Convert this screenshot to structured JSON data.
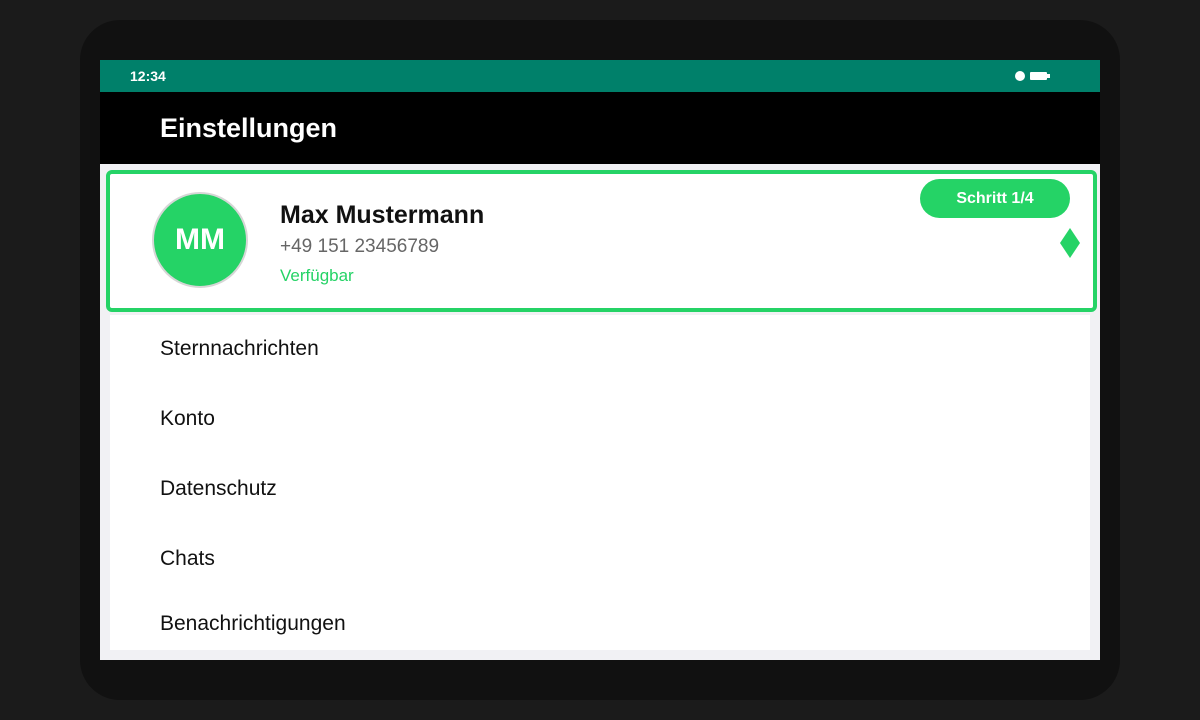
{
  "status_bar": {
    "time": "12:34",
    "icons": [
      "signal-dot-icon",
      "battery-icon"
    ]
  },
  "app_bar": {
    "title": "Einstellungen"
  },
  "profile": {
    "initials": "MM",
    "name": "Max Mustermann",
    "phone": "+49 151 23456789",
    "status": "Verfügbar"
  },
  "tour": {
    "step_label": "Schritt 1/4",
    "pointer_icon": "diamond-pointer-icon"
  },
  "settings": {
    "items": [
      {
        "label": "Sternnachrichten"
      },
      {
        "label": "Konto"
      },
      {
        "label": "Datenschutz"
      },
      {
        "label": "Chats"
      },
      {
        "label": "Benachrichtigungen"
      }
    ]
  },
  "colors": {
    "status_bar": "#00806a",
    "accent": "#25d366",
    "app_bar": "#000000",
    "frame": "#111111",
    "background": "#1b1b1b"
  }
}
